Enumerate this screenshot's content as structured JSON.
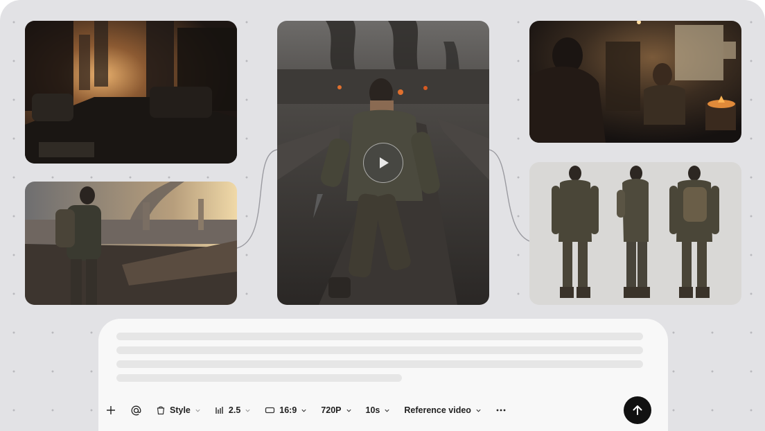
{
  "tiles": [
    {
      "name": "ruined-city-street-image"
    },
    {
      "name": "survivor-overlooking-city-image"
    },
    {
      "name": "running-survivor-video"
    },
    {
      "name": "bunker-conversation-image"
    },
    {
      "name": "character-turnaround-image"
    }
  ],
  "toolbar": {
    "add_icon": "plus-icon",
    "mention_icon": "at-icon",
    "style_label": "Style",
    "model_version": "2.5",
    "aspect_ratio": "16:9",
    "resolution": "720P",
    "duration": "10s",
    "reference_label": "Reference video",
    "more_icon": "ellipsis-icon",
    "send_icon": "arrow-up-icon"
  },
  "colors": {
    "canvas": "#e2e2e5",
    "dots": "#b9b9be",
    "composer": "#f8f8f8",
    "send_button": "#111111"
  }
}
